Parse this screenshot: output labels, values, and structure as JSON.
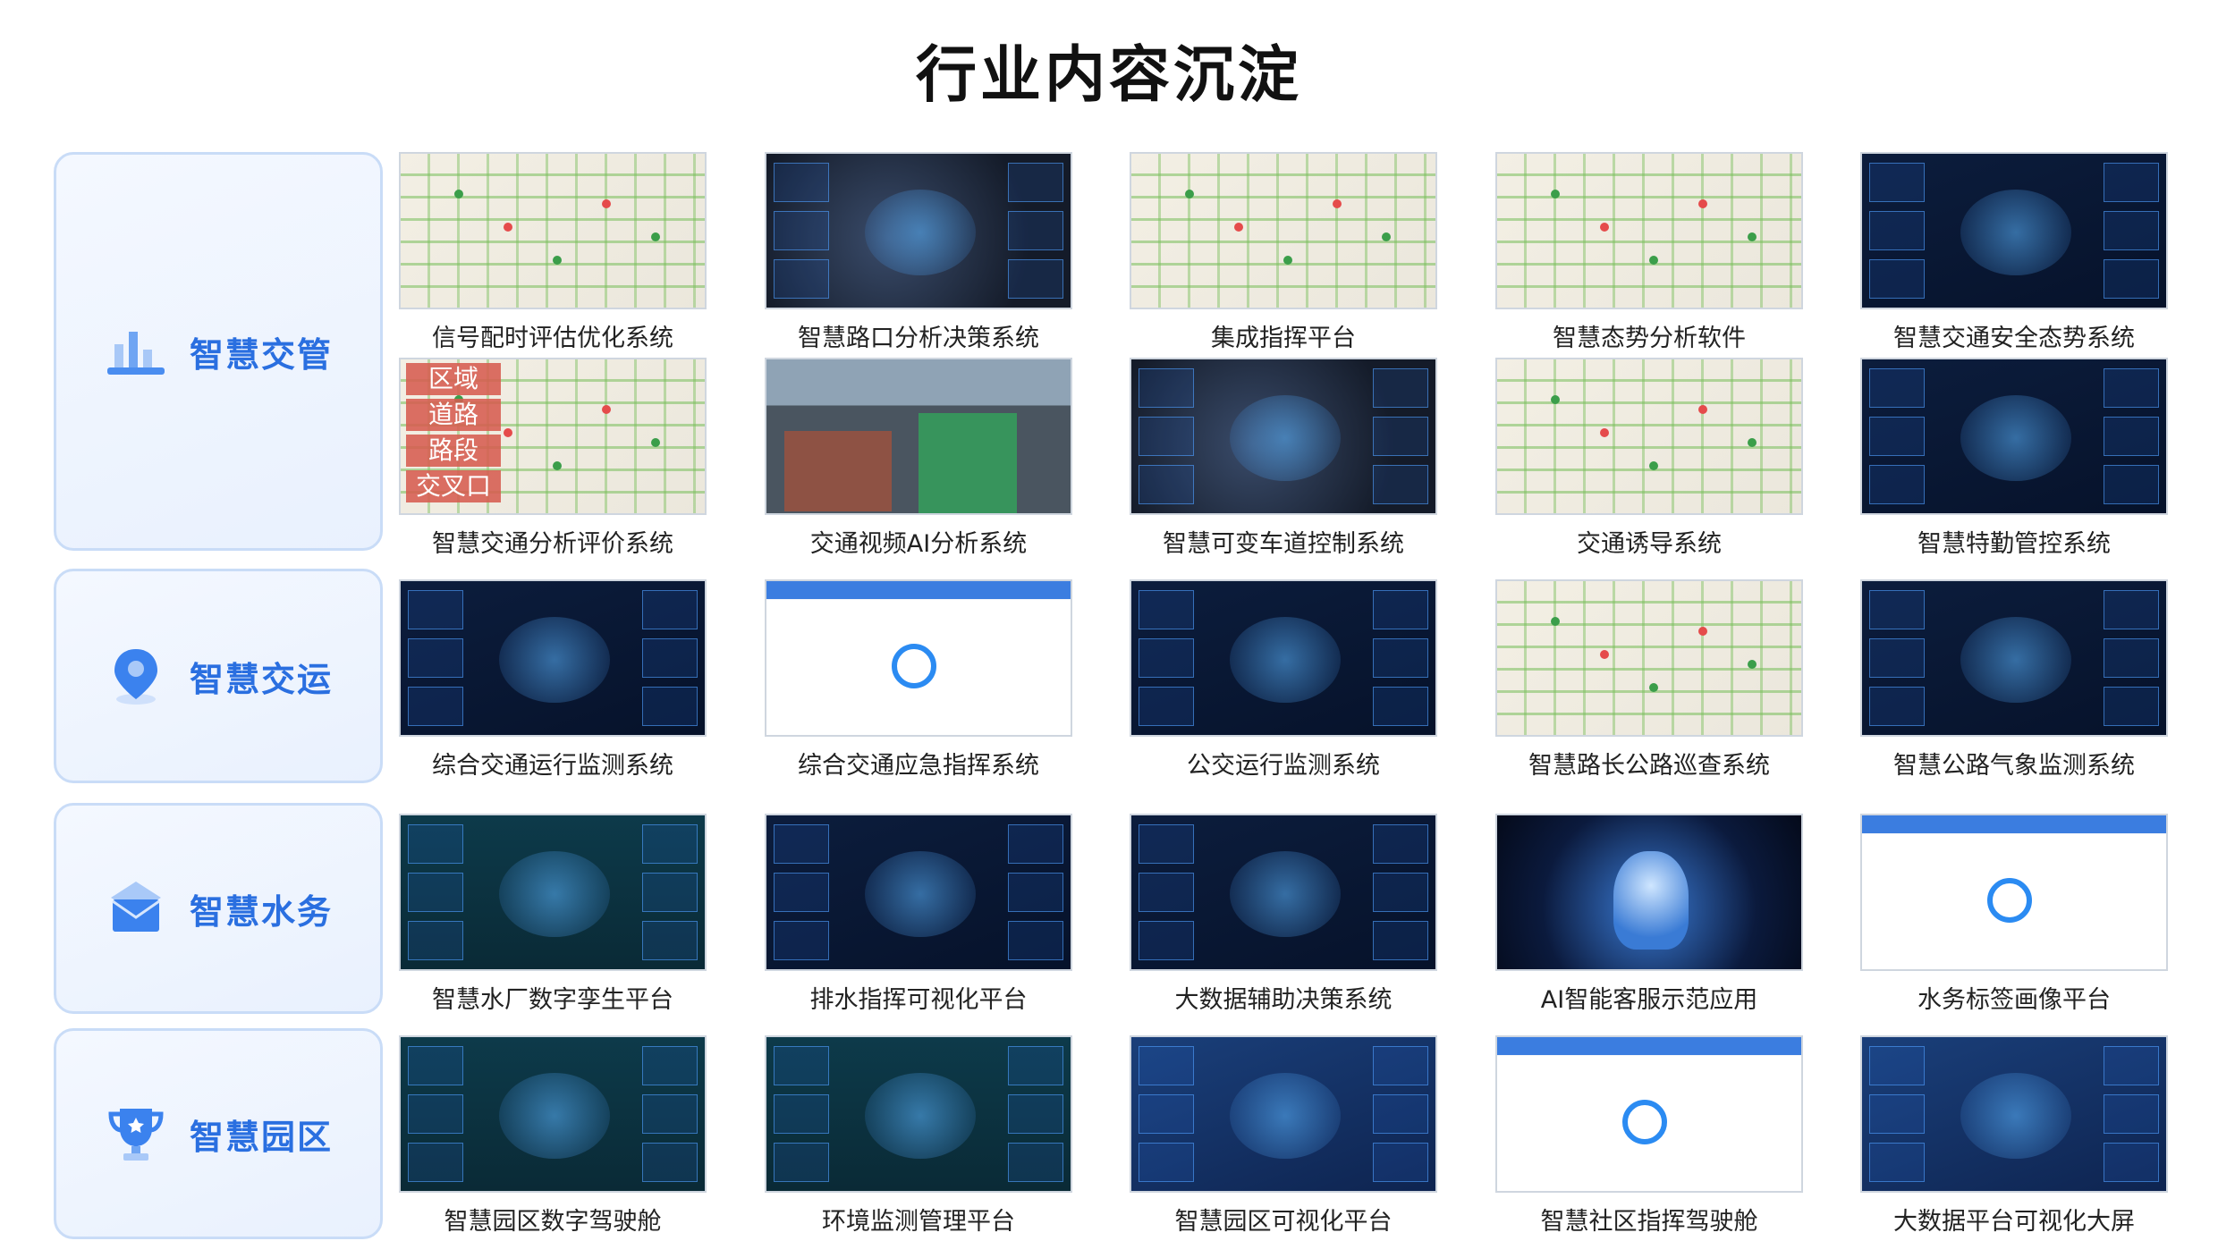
{
  "title": "行业内容沉淀",
  "categories": [
    {
      "label": "智慧交管",
      "icon": "bar-chart-icon"
    },
    {
      "label": "智慧交运",
      "icon": "location-pin-icon"
    },
    {
      "label": "智慧水务",
      "icon": "envelope-icon"
    },
    {
      "label": "智慧园区",
      "icon": "trophy-icon"
    }
  ],
  "tiles": [
    {
      "label": "信号配时评估优化系统",
      "style": "map"
    },
    {
      "label": "智慧路口分析决策系统",
      "style": "dark"
    },
    {
      "label": "集成指挥平台",
      "style": "map"
    },
    {
      "label": "智慧态势分析软件",
      "style": "map"
    },
    {
      "label": "智慧交通安全态势系统",
      "style": "navy"
    },
    {
      "label": "智慧交通分析评价系统",
      "style": "map",
      "overlay": [
        "区域",
        "道路",
        "路段",
        "交叉口"
      ]
    },
    {
      "label": "交通视频AI分析系统",
      "style": "road"
    },
    {
      "label": "智慧可变车道控制系统",
      "style": "dark"
    },
    {
      "label": "交通诱导系统",
      "style": "map"
    },
    {
      "label": "智慧特勤管控系统",
      "style": "navy"
    },
    {
      "label": "综合交通运行监测系统",
      "style": "navy"
    },
    {
      "label": "综合交通应急指挥系统",
      "style": "white"
    },
    {
      "label": "公交运行监测系统",
      "style": "navy"
    },
    {
      "label": "智慧路长公路巡查系统",
      "style": "map"
    },
    {
      "label": "智慧公路气象监测系统",
      "style": "navy"
    },
    {
      "label": "智慧水厂数字孪生平台",
      "style": "teal"
    },
    {
      "label": "排水指挥可视化平台",
      "style": "navy"
    },
    {
      "label": "大数据辅助决策系统",
      "style": "navy"
    },
    {
      "label": "AI智能客服示范应用",
      "style": "brain"
    },
    {
      "label": "水务标签画像平台",
      "style": "white"
    },
    {
      "label": "智慧园区数字驾驶舱",
      "style": "teal"
    },
    {
      "label": "环境监测管理平台",
      "style": "teal"
    },
    {
      "label": "智慧园区可视化平台",
      "style": "blue"
    },
    {
      "label": "智慧社区指挥驾驶舱",
      "style": "white"
    },
    {
      "label": "大数据平台可视化大屏",
      "style": "blue"
    }
  ]
}
